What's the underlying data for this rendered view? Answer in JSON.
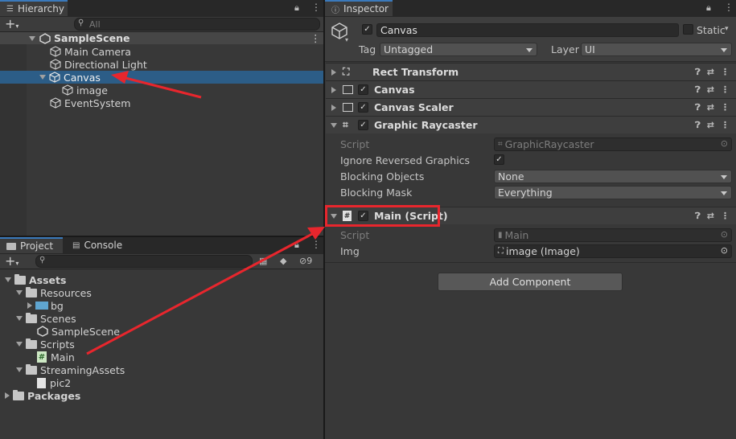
{
  "hierarchy": {
    "tab": "Hierarchy",
    "search_placeholder": "All",
    "scene": "SampleScene",
    "items": [
      "Main Camera",
      "Directional Light",
      "Canvas",
      "image",
      "EventSystem"
    ]
  },
  "project": {
    "tabs": [
      "Project",
      "Console"
    ],
    "hidden_count": "9",
    "tree": {
      "assets": "Assets",
      "resources": "Resources",
      "bg": "bg",
      "scenes": "Scenes",
      "samplescene": "SampleScene",
      "scripts": "Scripts",
      "main": "Main",
      "streaming": "StreamingAssets",
      "pic2": "pic2",
      "packages": "Packages"
    }
  },
  "inspector": {
    "tab": "Inspector",
    "object_name": "Canvas",
    "static_label": "Static",
    "tag_label": "Tag",
    "tag_value": "Untagged",
    "layer_label": "Layer",
    "layer_value": "UI",
    "components": [
      "Rect Transform",
      "Canvas",
      "Canvas Scaler",
      "Graphic Raycaster",
      "Main (Script)"
    ],
    "raycaster": {
      "script_label": "Script",
      "script_value": "GraphicRaycaster",
      "ignore_label": "Ignore Reversed Graphics",
      "blocking_objects_label": "Blocking Objects",
      "blocking_objects_value": "None",
      "blocking_mask_label": "Blocking Mask",
      "blocking_mask_value": "Everything"
    },
    "main_script": {
      "script_label": "Script",
      "script_value": "Main",
      "img_label": "Img",
      "img_value": "image (Image)"
    },
    "add_component": "Add Component"
  },
  "colors": {
    "selection": "#2c5d87",
    "annotation": "#e8262d",
    "accent": "#3a79bb"
  }
}
